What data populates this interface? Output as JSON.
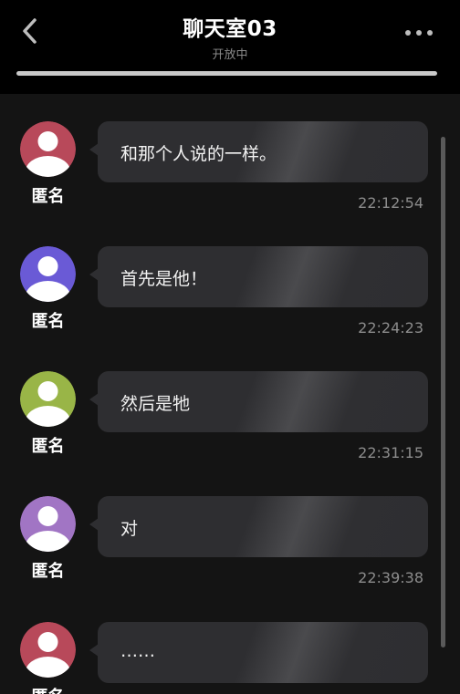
{
  "header": {
    "title": "聊天室03",
    "status": "开放中",
    "progress": 1.0,
    "back_icon": "chevron-left-icon",
    "more_icon": "more-dots-icon"
  },
  "messages": [
    {
      "sender": "匿名",
      "text": "和那个人说的一样。",
      "time": "22:12:54",
      "avatar_color": "#b8495a"
    },
    {
      "sender": "匿名",
      "text": "首先是他！",
      "time": "22:24:23",
      "avatar_color": "#6a5ad6"
    },
    {
      "sender": "匿名",
      "text": "然后是牠",
      "time": "22:31:15",
      "avatar_color": "#99b547"
    },
    {
      "sender": "匿名",
      "text": "对",
      "time": "22:39:38",
      "avatar_color": "#a175c4"
    },
    {
      "sender": "匿名",
      "text": "……",
      "time": "",
      "avatar_color": "#b8495a"
    }
  ]
}
